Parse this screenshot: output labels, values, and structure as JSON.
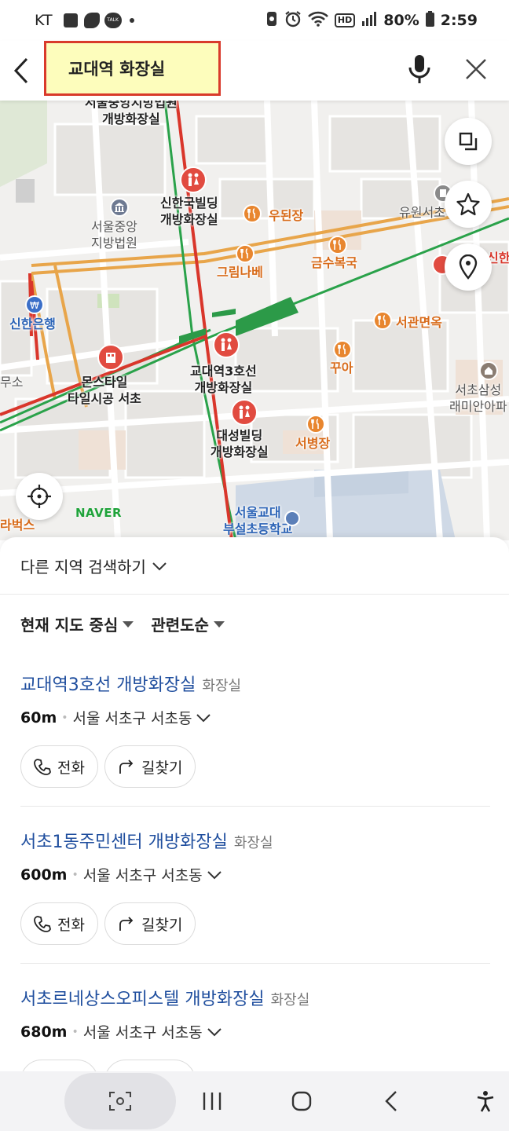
{
  "status_bar": {
    "carrier": "KT",
    "talk_badge": "TALK",
    "battery": "80%",
    "time": "2:59",
    "hd_badge": "HD"
  },
  "search": {
    "query": "교대역 화장실"
  },
  "map": {
    "labels": {
      "court_restroom": "서울중앙지방법원\n개방화장실",
      "shinhan_building": "신한국빌딩\n개방화장실",
      "woodoenjang": "우된장",
      "court": "서울중앙\n지방법원",
      "grimnabe": "그림나베",
      "geumsubokguk": "금수복국",
      "yuwon": "유원서초",
      "shinhan_bank": "신한은행",
      "seogwan": "서관면옥",
      "kkua": "꾸아",
      "gyodae_station": "교대역3호선\n개방화장실",
      "monstyle": "몬스타일\n타일시공 서초",
      "office": "무소",
      "seocho_raemian": "서초삼성\n래미안아파",
      "daesung": "대성빌딩\n개방화장실",
      "seobyeongjang": "서병장",
      "school": "서울교대\n부설초등학교",
      "starbucks": "라벅스",
      "shinhan_right": "신한"
    },
    "logo": "NAVER"
  },
  "sheet": {
    "other_region": "다른 지역 검색하기",
    "filter_center": "현재 지도 중심",
    "filter_sort": "관련도순",
    "call_label": "전화",
    "route_label": "길찾기",
    "results": [
      {
        "name": "교대역3호선 개방화장실",
        "category": "화장실",
        "distance": "60m",
        "address": "서울 서초구 서초동"
      },
      {
        "name": "서초1동주민센터 개방화장실",
        "category": "화장실",
        "distance": "600m",
        "address": "서울 서초구 서초동"
      },
      {
        "name": "서초르네상스오피스텔 개방화장실",
        "category": "화장실",
        "distance": "680m",
        "address": "서울 서초구 서초동"
      }
    ]
  },
  "colors": {
    "link_blue": "#1f4e9e",
    "highlight_yellow": "#fdfdbc",
    "highlight_border": "#d93a2b",
    "pin_red": "#e14b40",
    "pin_orange": "#e8862f",
    "naver_green": "#1fa33a"
  }
}
